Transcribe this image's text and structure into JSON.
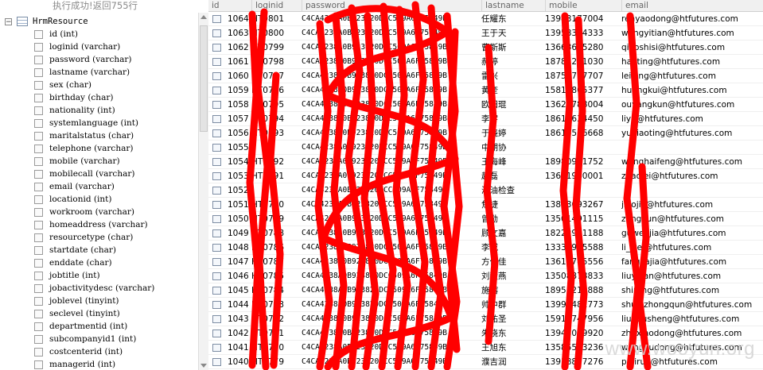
{
  "status_text": "执行成功!返回755行",
  "tree": {
    "root_label": "HrmResource",
    "expander": "−",
    "fields": [
      "id (int)",
      "loginid (varchar)",
      "password (varchar)",
      "lastname (varchar)",
      "sex (char)",
      "birthday (char)",
      "nationality (int)",
      "systemlanguage (int)",
      "maritalstatus (char)",
      "telephone (varchar)",
      "mobile (varchar)",
      "mobilecall (varchar)",
      "email (varchar)",
      "locationid (int)",
      "workroom (varchar)",
      "homeaddress (varchar)",
      "resourcetype (char)",
      "startdate (char)",
      "enddate (char)",
      "jobtitle (int)",
      "jobactivitydesc (varchar)",
      "joblevel (tinyint)",
      "seclevel (tinyint)",
      "departmentid (int)",
      "subcompanyid1 (int)",
      "costcenterid (int)",
      "managerid (int)"
    ]
  },
  "grid": {
    "columns": [
      "id",
      "loginid",
      "password",
      "lastname",
      "mobile",
      "email"
    ],
    "rows": [
      {
        "id": "1064",
        "loginid": "HT0801",
        "password": "C4CA4238A0B923820DCC509A6F75849B",
        "lastname": "任耀东",
        "mobile": "13983177004",
        "email": "renyaodong@htfutures.com"
      },
      {
        "id": "1063",
        "loginid": "HT0800",
        "password": "C4CA4238A0B923820DCC509A6F75849B",
        "lastname": "王于天",
        "mobile": "13958324333",
        "email": "wangyitian@htfutures.com"
      },
      {
        "id": "1062",
        "loginid": "HT0799",
        "password": "C4CA4238A0B923820DCC509A6F75849B",
        "lastname": "曹斯斯",
        "mobile": "13663685280",
        "email": "qiaoshisi@htfutures.com"
      },
      {
        "id": "1061",
        "loginid": "HT0798",
        "password": "C4CA4238A0B923820DCC509A6F75849B",
        "lastname": "郝婷",
        "mobile": "18782211030",
        "email": "haoting@htfutures.com"
      },
      {
        "id": "1060",
        "loginid": "HT0797",
        "password": "C4CA4238A0B923820DCC509A6F75849B",
        "lastname": "雷兴",
        "mobile": "18754757707",
        "email": "leixing@htfutures.com"
      },
      {
        "id": "1059",
        "loginid": "HT0796",
        "password": "C4CA4238A0B923820DCC509A6F75849B",
        "lastname": "黄奎",
        "mobile": "15813805377",
        "email": "huangkui@htfutures.com"
      },
      {
        "id": "1058",
        "loginid": "HT0795",
        "password": "C4CA4238A0B923820DCC509A6F75849B",
        "lastname": "欧阳琨",
        "mobile": "13621788004",
        "email": "ouyangkun@htfutures.com"
      },
      {
        "id": "1057",
        "loginid": "HT0794",
        "password": "C4CA4238A0B923820DCC509A6F75849B",
        "lastname": "李宇",
        "mobile": "18613634450",
        "email": "liyu@htfutures.com"
      },
      {
        "id": "1056",
        "loginid": "HT0793",
        "password": "C4CA4238A0B923820DCC509A6F75849B",
        "lastname": "于晓婷",
        "mobile": "18616566668",
        "email": "yuxiaoting@htfutures.com"
      },
      {
        "id": "1055",
        "loginid": "",
        "password": "C4CA4238A0B923820DCC509A6F75849B",
        "lastname": "中期协",
        "mobile": "",
        "email": ""
      },
      {
        "id": "1054",
        "loginid": "HT0792",
        "password": "C4CA4238A0B923820DCC509A6F75849B",
        "lastname": "王海峰",
        "mobile": "18980911752",
        "email": "wanghaifeng@htfutures.com"
      },
      {
        "id": "1053",
        "loginid": "HT0791",
        "password": "C4CA4238A0B923820DCC509A6F75849B",
        "lastname": "赵磊",
        "mobile": "13611960001",
        "email": "zhaolei@htfutures.com"
      },
      {
        "id": "1052",
        "loginid": "",
        "password": "C4CA4238A0B923820DCC509A6F75849B",
        "lastname": "海油检查",
        "mobile": "",
        "email": ""
      },
      {
        "id": "1051",
        "loginid": "HT0790",
        "password": "C4CA4238A0B923820DCC509A6F75849B",
        "lastname": "焦捷",
        "mobile": "13893693267",
        "email": "jiaojie@htfutures.com"
      },
      {
        "id": "1050",
        "loginid": "HT0789",
        "password": "C4CA4238A0B923820DCC509A6F75849B",
        "lastname": "曾勋",
        "mobile": "13501491115",
        "email": "zengxun@htfutures.com"
      },
      {
        "id": "1049",
        "loginid": "HT0788",
        "password": "C4CA4238A0B923820DCC509A6F75849B",
        "lastname": "顾文嘉",
        "mobile": "18222981188",
        "email": "guwenjia@htfutures.com"
      },
      {
        "id": "1048",
        "loginid": "HT0786",
        "password": "C4CA4238A0B923820DCC509A6F75849B",
        "lastname": "李威",
        "mobile": "13333985588",
        "email": "li_wei@htfutures.com"
      },
      {
        "id": "1047",
        "loginid": "HT0787",
        "password": "C4CA4238A0B923820DCC509A6F75849B",
        "lastname": "方佳佳",
        "mobile": "13611785556",
        "email": "fangjiajia@htfutures.com"
      },
      {
        "id": "1046",
        "loginid": "HT0785",
        "password": "C4CA4238A0B923820DCC509A6F75849B",
        "lastname": "刘毅燕",
        "mobile": "13508878833",
        "email": "liuyiyan@htfutures.com"
      },
      {
        "id": "1045",
        "loginid": "HT0784",
        "password": "C4CA4238A0B923820DCC509A6F75849B",
        "lastname": "施榕",
        "mobile": "18951217888",
        "email": "shirong@htfutures.com"
      },
      {
        "id": "1044",
        "loginid": "HT0783",
        "password": "C4CA4238A0B923820DCC509A6F75849B",
        "lastname": "帅中群",
        "mobile": "13996482773",
        "email": "shuaizhongqun@htfutures.com"
      },
      {
        "id": "1043",
        "loginid": "HT0782",
        "password": "C4CA4238A0B923820DCC509A6F75849B",
        "lastname": "刘祐圣",
        "mobile": "15919747956",
        "email": "liuhousheng@htfutures.com"
      },
      {
        "id": "1042",
        "loginid": "HT0781",
        "password": "C4CA4238A0B923820DCC509A6F75849B",
        "lastname": "朱晓东",
        "mobile": "13943089920",
        "email": "zhuxiaodong@htfutures.com"
      },
      {
        "id": "1041",
        "loginid": "HT0780",
        "password": "C4CA4238A0B923820DCC509A6F75849B",
        "lastname": "王旭东",
        "mobile": "13585583236",
        "email": "wangxudong@htfutures.com"
      },
      {
        "id": "1040",
        "loginid": "HT0779",
        "password": "C4CA4238A0B923820DCC509A6F75849B",
        "lastname": "濮吉润",
        "mobile": "13918877276",
        "email": "pujirun@htfutures.com"
      }
    ]
  },
  "watermark": "www.wooyun.org",
  "colors": {
    "redaction": "#ff0000",
    "header_bg": "#f0f0f0",
    "status_text": "#8a8a8a"
  }
}
